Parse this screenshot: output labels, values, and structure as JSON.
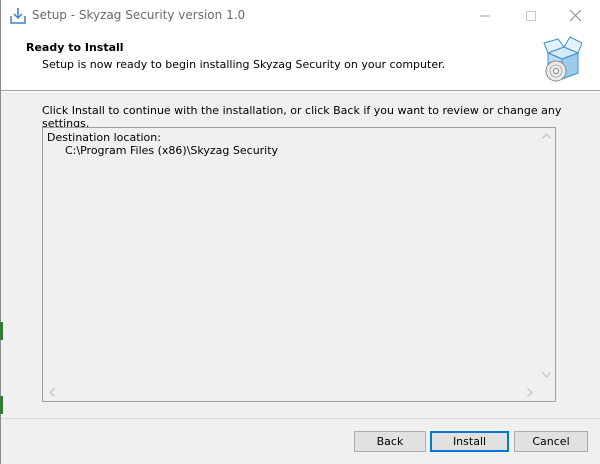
{
  "window": {
    "title": "Setup - Skyzag Security version 1.0",
    "controls": {
      "minimize": "─",
      "maximize": "☐",
      "close": "✕"
    }
  },
  "header": {
    "heading": "Ready to Install",
    "subheading": "Setup is now ready to begin installing Skyzag Security on your computer."
  },
  "body": {
    "instruction": "Click Install to continue with the installation, or click Back if you want to review or change any settings.",
    "memo": {
      "label": "Destination location:",
      "path": "C:\\Program Files (x86)\\Skyzag Security"
    }
  },
  "buttons": {
    "back": "Back",
    "install": "Install",
    "cancel": "Cancel"
  },
  "icons": {
    "title": "installer-icon",
    "header": "package-disc-icon"
  },
  "colors": {
    "accent": "#0078d7",
    "window_bg": "#f0f0f0",
    "header_bg": "#ffffff"
  }
}
